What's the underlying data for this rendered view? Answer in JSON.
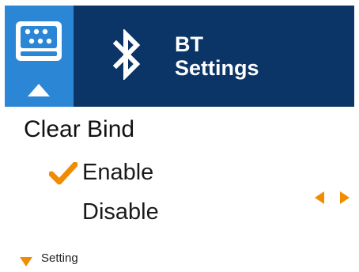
{
  "header": {
    "title_line1": "BT",
    "title_line2": "Settings",
    "icons": [
      "keyboard-icon",
      "up-arrow-icon",
      "bluetooth-icon"
    ]
  },
  "setting": {
    "name": "Clear Bind",
    "options": [
      {
        "label": "Enable",
        "selected": true
      },
      {
        "label": "Disable",
        "selected": false
      }
    ]
  },
  "footer": {
    "label": "Setting",
    "icon": "down-triangle-icon"
  },
  "colors": {
    "header_bg": "#0a3566",
    "menu_tile_bg": "#2b86d6",
    "accent": "#f08c00"
  }
}
